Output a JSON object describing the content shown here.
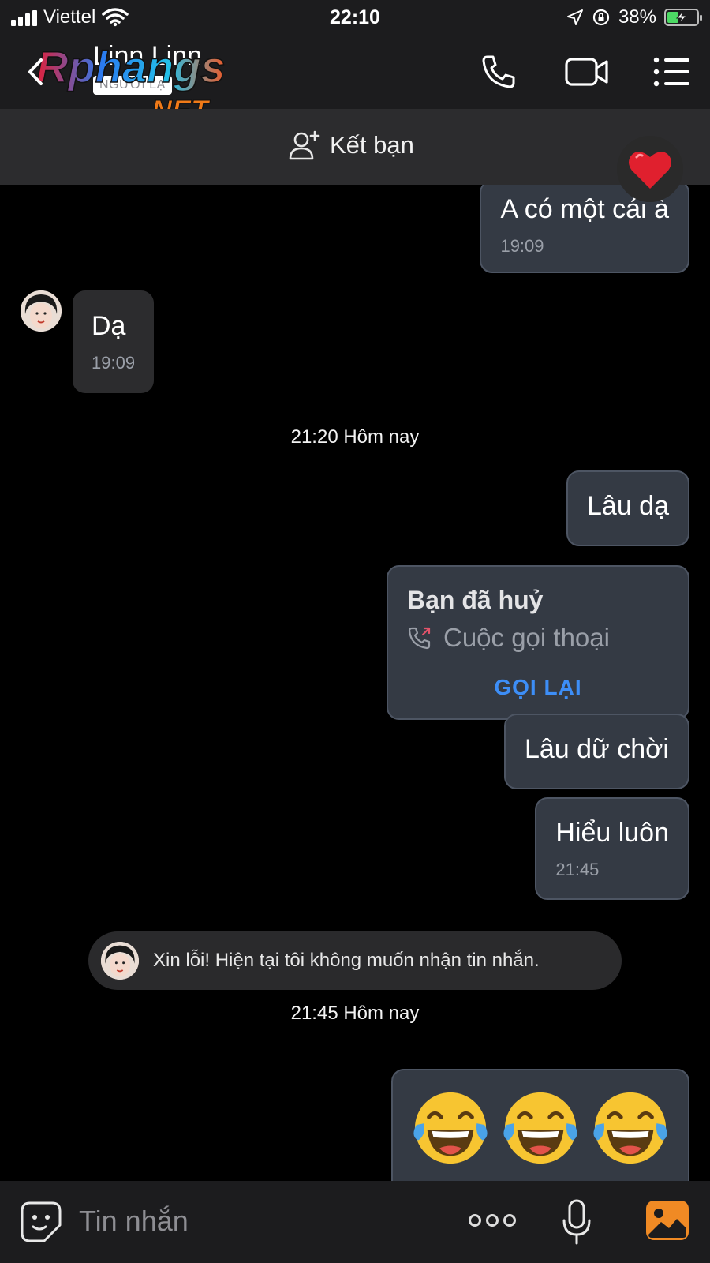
{
  "status_bar": {
    "carrier": "Viettel",
    "time": "22:10",
    "battery_text": "38%",
    "battery_level": 0.38,
    "icons": [
      "signal-icon",
      "wifi-icon",
      "location-icon",
      "orientation-lock-icon",
      "battery-charging-icon"
    ]
  },
  "header": {
    "contact_name": "Linn Linn",
    "badge": "NGƯỜI LẠ",
    "watermark_text": "Rphangs.NET",
    "icons": [
      "back-icon",
      "phone-icon",
      "video-call-icon",
      "menu-list-icon"
    ]
  },
  "friend_bar": {
    "label": "Kết bạn",
    "icon": "add-friend-icon"
  },
  "messages": [
    {
      "direction": "out",
      "text": "A có một cái à",
      "time": "19:09"
    },
    {
      "direction": "in",
      "text": "Dạ",
      "time": "19:09"
    },
    {
      "type": "timestamp",
      "text": "21:20 Hôm nay"
    },
    {
      "direction": "out",
      "text": "Lâu dạ"
    },
    {
      "direction": "out",
      "type": "call",
      "title": "Bạn đã huỷ",
      "subtitle": "Cuộc gọi thoại",
      "action": "GỌI LẠI"
    },
    {
      "direction": "out",
      "text": "Lâu dữ chời"
    },
    {
      "direction": "out",
      "text": "Hiểu luôn",
      "time": "21:45"
    },
    {
      "type": "notice",
      "text": "Xin lỗi! Hiện tại tôi không muốn nhận tin nhắn."
    },
    {
      "type": "timestamp",
      "text": "21:45 Hôm nay"
    },
    {
      "direction": "out",
      "type": "emoji",
      "emojis": [
        "tears-of-joy-emoji",
        "tears-of-joy-emoji",
        "tears-of-joy-emoji"
      ]
    }
  ],
  "input_bar": {
    "placeholder": "Tin nhắn",
    "icons": [
      "sticker-icon",
      "more-icon",
      "microphone-icon",
      "image-icon"
    ]
  },
  "colors": {
    "outgoing_bubble": "#343a44",
    "incoming_bubble": "#2c2c2e",
    "link_blue": "#3d8ef7",
    "heart_red": "#e0202e",
    "image_button": "#f08a24"
  }
}
